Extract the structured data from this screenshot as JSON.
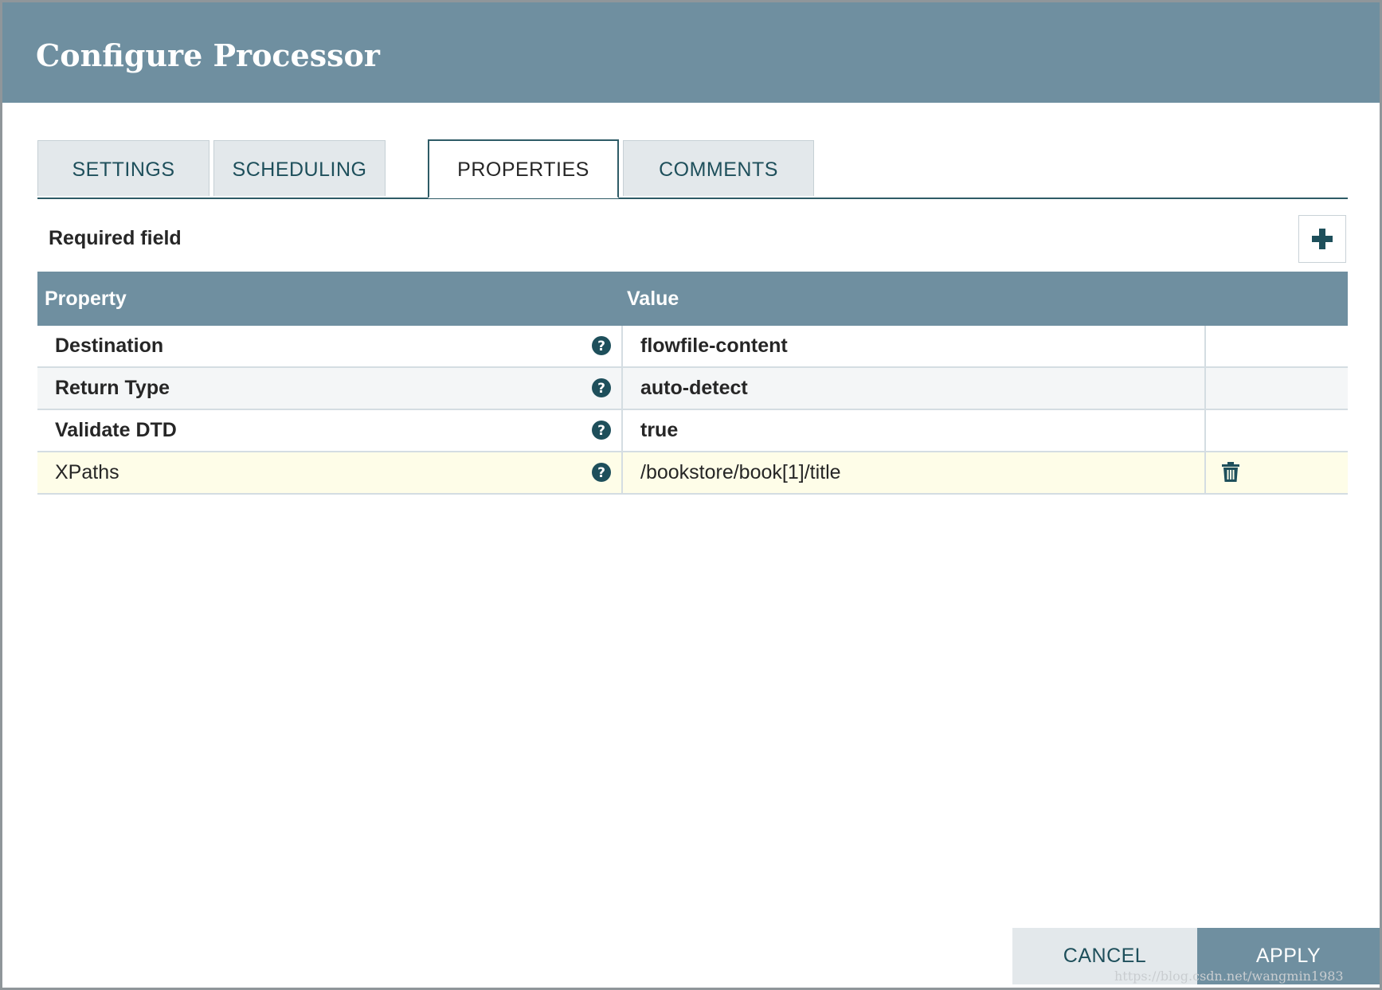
{
  "dialog": {
    "title": "Configure Processor"
  },
  "tabs": [
    {
      "label": "SETTINGS",
      "active": false
    },
    {
      "label": "SCHEDULING",
      "active": false
    },
    {
      "label": "PROPERTIES",
      "active": true
    },
    {
      "label": "COMMENTS",
      "active": false
    }
  ],
  "properties": {
    "required_label": "Required field",
    "add_icon": "plus-icon",
    "columns": [
      "Property",
      "Value"
    ],
    "rows": [
      {
        "name": "Destination",
        "value": "flowfile-content",
        "required": true,
        "deletable": false
      },
      {
        "name": "Return Type",
        "value": "auto-detect",
        "required": true,
        "deletable": false
      },
      {
        "name": "Validate DTD",
        "value": "true",
        "required": true,
        "deletable": false
      },
      {
        "name": "XPaths",
        "value": "/bookstore/book[1]/title",
        "required": false,
        "deletable": true,
        "selected": true
      }
    ]
  },
  "footer": {
    "cancel_label": "CANCEL",
    "apply_label": "APPLY"
  },
  "watermark": "https://blog.csdn.net/wangmin1983",
  "colors": {
    "header": "#6f8fa0",
    "accent": "#1e4f5b",
    "selected_row": "#fefde8"
  }
}
